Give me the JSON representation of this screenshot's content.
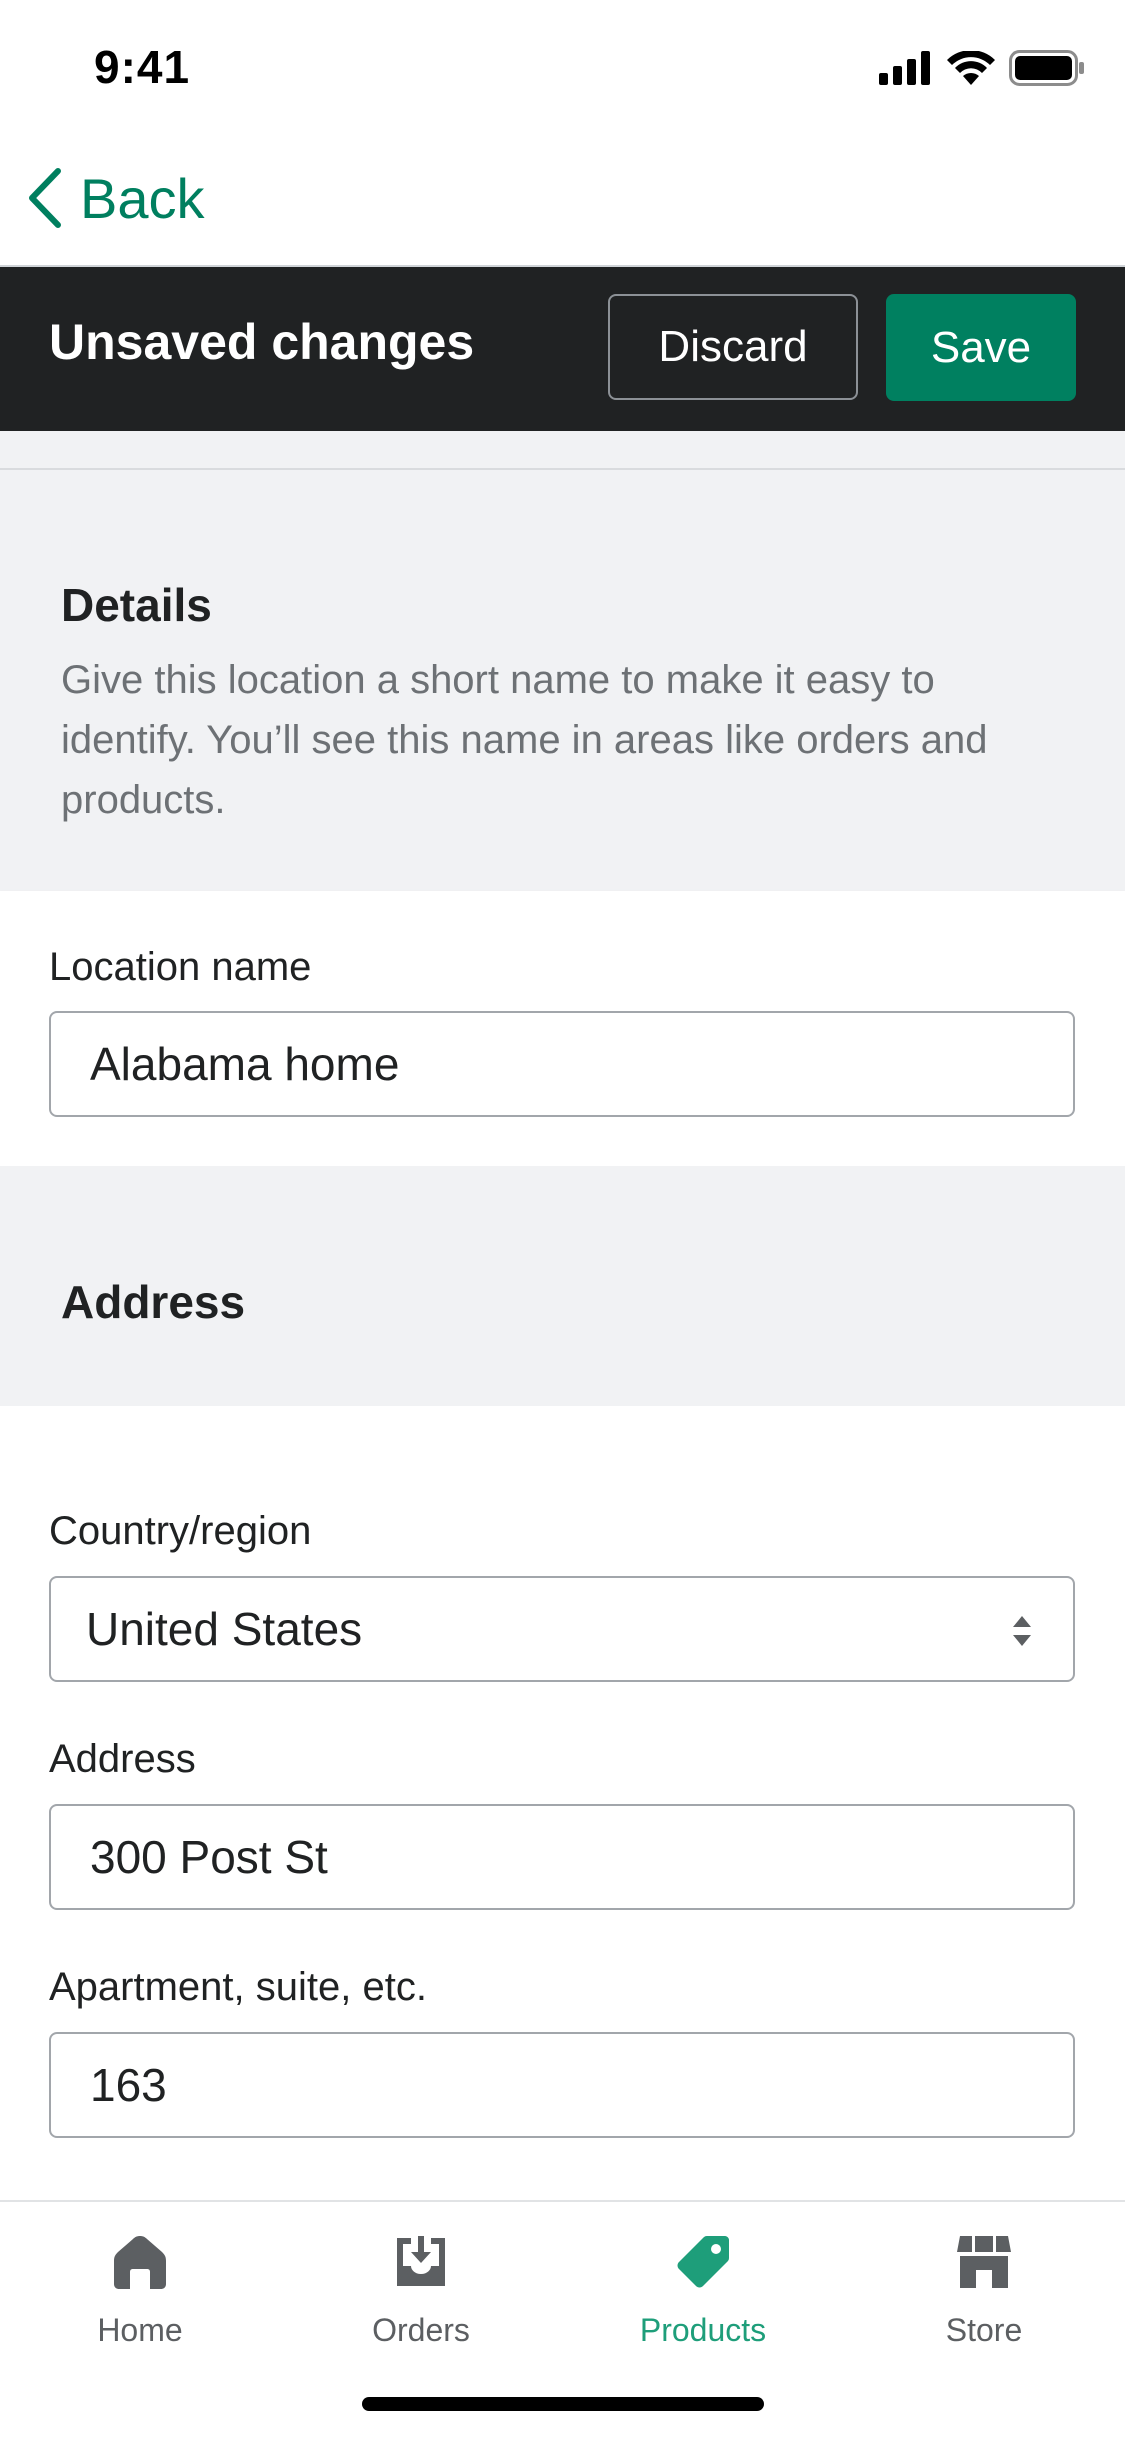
{
  "status_bar": {
    "time": "9:41"
  },
  "nav": {
    "back_label": "Back"
  },
  "context_bar": {
    "title": "Unsaved changes",
    "discard_label": "Discard",
    "save_label": "Save"
  },
  "details": {
    "heading": "Details",
    "description": "Give this location a short name to make it easy to identify. You’ll see this name in areas like orders and products.",
    "location_name_label": "Location name",
    "location_name_value": "Alabama home"
  },
  "address": {
    "heading": "Address",
    "country_label": "Country/region",
    "country_value": "United States",
    "address_label": "Address",
    "address_value": "300 Post St",
    "apartment_label": "Apartment, suite, etc.",
    "apartment_value": "163"
  },
  "tabs": [
    {
      "label": "Home",
      "icon": "home-icon",
      "active": false
    },
    {
      "label": "Orders",
      "icon": "orders-icon",
      "active": false
    },
    {
      "label": "Products",
      "icon": "tag-icon",
      "active": true
    },
    {
      "label": "Store",
      "icon": "store-icon",
      "active": false
    }
  ],
  "colors": {
    "accent": "#008060",
    "active_tab": "#1e9e7a",
    "context_bar": "#202223"
  }
}
